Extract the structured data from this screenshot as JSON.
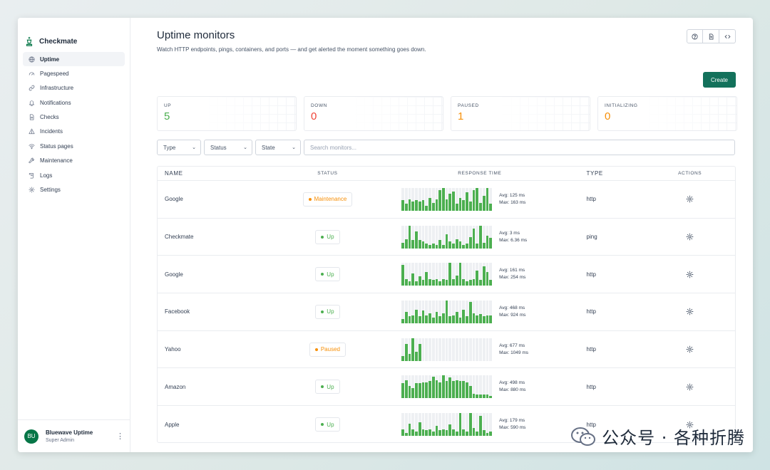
{
  "app": {
    "name": "Checkmate",
    "brand_icon": "chess-king-icon",
    "accent": "#13715b"
  },
  "sidebar": {
    "items": [
      {
        "label": "Uptime",
        "icon": "globe-icon",
        "active": true
      },
      {
        "label": "Pagespeed",
        "icon": "gauge-icon"
      },
      {
        "label": "Infrastructure",
        "icon": "link-icon"
      },
      {
        "label": "Notifications",
        "icon": "bell-icon"
      },
      {
        "label": "Checks",
        "icon": "document-icon"
      },
      {
        "label": "Incidents",
        "icon": "warning-icon"
      },
      {
        "label": "Status pages",
        "icon": "wifi-icon"
      },
      {
        "label": "Maintenance",
        "icon": "wrench-icon"
      },
      {
        "label": "Logs",
        "icon": "scroll-icon"
      },
      {
        "label": "Settings",
        "icon": "gear-icon"
      }
    ],
    "user": {
      "initials": "BU",
      "name": "Bluewave Uptime",
      "role": "Super Admin"
    }
  },
  "header": {
    "title": "Uptime monitors",
    "subtitle": "Watch HTTP endpoints, pings, containers, and ports — and get alerted the moment something goes down.",
    "create_label": "Create",
    "actions": [
      "help-icon",
      "docs-icon",
      "code-icon"
    ]
  },
  "stats": [
    {
      "label": "UP",
      "value": "5",
      "color": "#4caf50"
    },
    {
      "label": "DOWN",
      "value": "0",
      "color": "#f04438"
    },
    {
      "label": "PAUSED",
      "value": "1",
      "color": "#f79009"
    },
    {
      "label": "INITIALIZING",
      "value": "0",
      "color": "#f79009"
    }
  ],
  "filters": {
    "type": "Type",
    "status": "Status",
    "state": "State",
    "search_placeholder": "Search monitors..."
  },
  "table": {
    "headers": {
      "name": "NAME",
      "status": "STATUS",
      "response": "RESPONSE TIME",
      "type": "TYPE",
      "actions": "ACTIONS"
    },
    "rows": [
      {
        "name": "Google",
        "status": "Maintenance",
        "status_color": "#f79009",
        "type": "http",
        "avg": "Avg: 125 ms",
        "max": "Max: 163 ms",
        "bars": [
          0.45,
          0.3,
          0.5,
          0.4,
          0.45,
          0.4,
          0.45,
          0.2,
          0.55,
          0.35,
          0.5,
          0.9,
          1.0,
          0.5,
          0.75,
          0.85,
          0.3,
          0.55,
          0.45,
          0.8,
          0.4,
          0.9,
          1.0,
          0.35,
          0.65,
          1.05,
          0.3
        ]
      },
      {
        "name": "Checkmate",
        "status": "Up",
        "status_color": "#4caf50",
        "type": "ping",
        "avg": "Avg: 3 ms",
        "max": "Max: 6.36 ms",
        "bars": [
          0.25,
          0.4,
          1.0,
          0.35,
          0.75,
          0.35,
          0.3,
          0.2,
          0.15,
          0.2,
          0.15,
          0.35,
          0.15,
          0.6,
          0.3,
          0.2,
          0.4,
          0.3,
          0.15,
          0.2,
          0.5,
          0.85,
          0.2,
          1.05,
          0.25,
          0.55,
          0.45
        ]
      },
      {
        "name": "Google",
        "status": "Up",
        "status_color": "#4caf50",
        "type": "http",
        "avg": "Avg: 161 ms",
        "max": "Max: 254 ms",
        "bars": [
          0.9,
          0.3,
          0.2,
          0.55,
          0.2,
          0.4,
          0.25,
          0.6,
          0.3,
          0.25,
          0.3,
          0.2,
          0.3,
          0.25,
          1.0,
          0.3,
          0.45,
          1.0,
          0.3,
          0.2,
          0.25,
          0.3,
          0.65,
          0.25,
          0.85,
          0.6,
          0.25
        ]
      },
      {
        "name": "Facebook",
        "status": "Up",
        "status_color": "#4caf50",
        "type": "http",
        "avg": "Avg: 468 ms",
        "max": "Max: 924 ms",
        "bars": [
          0.2,
          0.5,
          0.3,
          0.35,
          0.6,
          0.3,
          0.55,
          0.35,
          0.45,
          0.25,
          0.5,
          0.3,
          0.45,
          1.0,
          0.3,
          0.35,
          0.5,
          0.25,
          0.6,
          0.3,
          0.95,
          0.45,
          0.35,
          0.4,
          0.3,
          0.35,
          0.35
        ]
      },
      {
        "name": "Yahoo",
        "status": "Paused",
        "status_color": "#f79009",
        "type": "http",
        "avg": "Avg: 677 ms",
        "max": "Max: 1049 ms",
        "bars": [
          0.2,
          0.75,
          0.3,
          1.05,
          0.4,
          0.75,
          0,
          0,
          0,
          0,
          0,
          0,
          0,
          0,
          0,
          0,
          0,
          0,
          0,
          0,
          0,
          0,
          0,
          0,
          0,
          0,
          0
        ]
      },
      {
        "name": "Amazon",
        "status": "Up",
        "status_color": "#4caf50",
        "type": "http",
        "avg": "Avg: 498 ms",
        "max": "Max: 880 ms",
        "bars": [
          0.65,
          0.8,
          0.55,
          0.45,
          0.65,
          0.65,
          0.7,
          0.7,
          0.75,
          0.95,
          0.8,
          0.7,
          1.0,
          0.75,
          0.9,
          0.75,
          0.8,
          0.75,
          0.75,
          0.7,
          0.55,
          0.2,
          0.15,
          0.15,
          0.15,
          0.15,
          0.1
        ]
      },
      {
        "name": "Apple",
        "status": "Up",
        "status_color": "#4caf50",
        "type": "http",
        "avg": "Avg: 179 ms",
        "max": "Max: 590 ms",
        "bars": [
          0.3,
          0.15,
          0.55,
          0.3,
          0.2,
          0.6,
          0.3,
          0.25,
          0.3,
          0.2,
          0.45,
          0.25,
          0.3,
          0.25,
          0.5,
          0.3,
          0.2,
          1.0,
          0.3,
          0.2,
          1.05,
          0.35,
          0.2,
          0.9,
          0.25,
          0.15,
          0.2
        ]
      }
    ]
  },
  "watermark": {
    "text": "公众号 · 各种折腾",
    "icon": "wechat-icon"
  }
}
